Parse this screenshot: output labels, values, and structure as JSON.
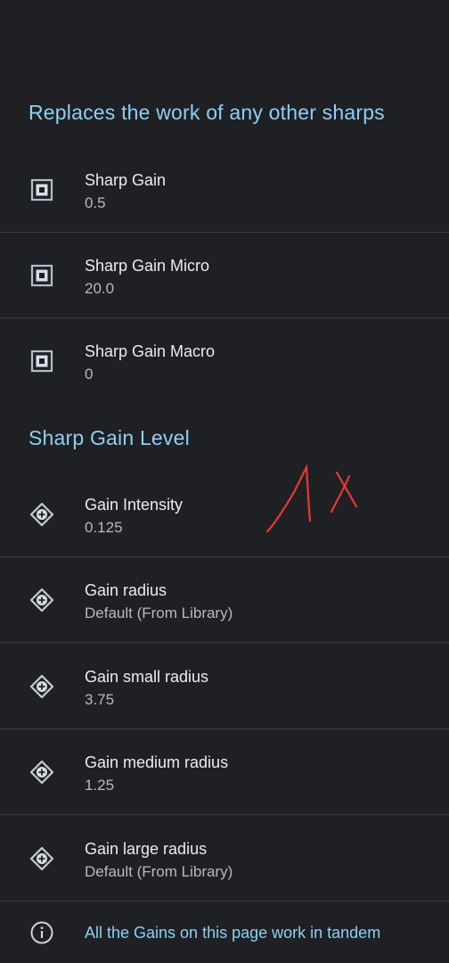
{
  "sections": {
    "replaces": {
      "title": "Replaces the work of any other sharps"
    },
    "level": {
      "title": "Sharp Gain Level"
    }
  },
  "sharp_items": [
    {
      "title": "Sharp Gain",
      "summary": "0.5",
      "icon": "square-button-icon"
    },
    {
      "title": "Sharp Gain Micro",
      "summary": "20.0",
      "icon": "square-button-icon"
    },
    {
      "title": "Sharp Gain Macro",
      "summary": "0",
      "icon": "square-button-icon"
    }
  ],
  "gain_items": [
    {
      "title": "Gain Intensity",
      "summary": "0.125",
      "icon": "diamond-plus-icon"
    },
    {
      "title": "Gain radius",
      "summary": "Default (From Library)",
      "icon": "diamond-plus-icon"
    },
    {
      "title": "Gain small radius",
      "summary": "3.75",
      "icon": "diamond-plus-icon"
    },
    {
      "title": "Gain medium radius",
      "summary": "1.25",
      "icon": "diamond-plus-icon"
    },
    {
      "title": "Gain large radius",
      "summary": "Default (From Library)",
      "icon": "diamond-plus-icon"
    }
  ],
  "footer": {
    "note": "All the Gains on this page work in tandem",
    "icon": "info-icon"
  },
  "annotation": {
    "text": "1x",
    "color": "#e53935"
  },
  "colors": {
    "background": "#1f2023",
    "accent": "#8ecff5",
    "divider": "#3a3b3e"
  }
}
